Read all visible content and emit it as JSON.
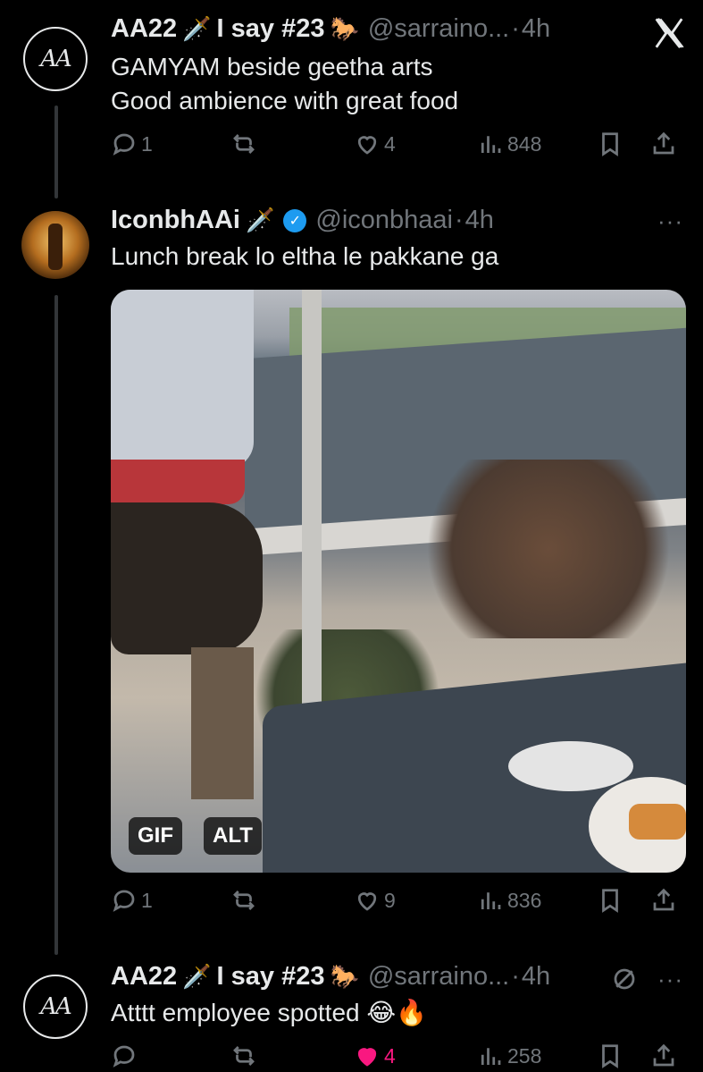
{
  "tweets": [
    {
      "name": "AA22",
      "emoji1": "🗡️",
      "tagline": "I say #23",
      "emoji2": "🐎",
      "handle": "@sarraino...",
      "sep": "·",
      "time": "4h",
      "text_lines": [
        "GAMYAM beside geetha arts",
        "Good ambience with great food"
      ],
      "replies": "1",
      "likes": "4",
      "views": "848"
    },
    {
      "name": "IconbhAAi",
      "emoji1": "🗡️",
      "handle": "@iconbhaai",
      "sep": "·",
      "time": "4h",
      "text_lines": [
        "Lunch break lo eltha le pakkane ga"
      ],
      "media_badges": [
        "GIF",
        "ALT"
      ],
      "replies": "1",
      "likes": "9",
      "views": "836",
      "more": "···"
    },
    {
      "name": "AA22",
      "emoji1": "🗡️",
      "tagline": "I say #23",
      "emoji2": "🐎",
      "handle": "@sarraino...",
      "sep": "·",
      "time": "4h",
      "text_lines": [
        "Atttt employee spotted 😂🔥"
      ],
      "likes": "4",
      "views": "258",
      "more": "···"
    }
  ],
  "avatar_aa_text": "AA",
  "colors": {
    "like": "#f91880",
    "verified": "#1d9bf0",
    "muted": "#71767b",
    "text": "#e7e9ea"
  }
}
